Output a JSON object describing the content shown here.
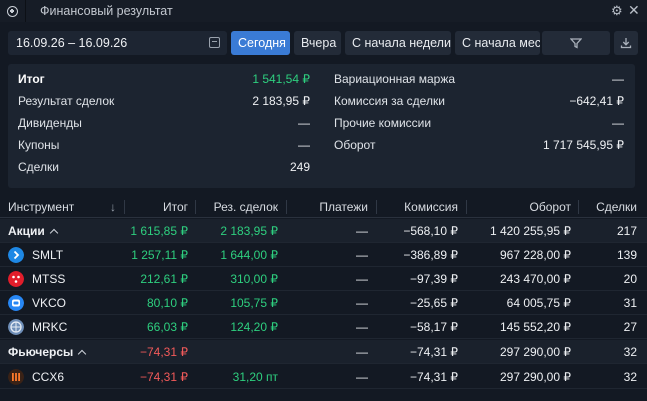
{
  "titlebar": {
    "title": "Финансовый результат"
  },
  "filters": {
    "date_range": "16.09.26 – 16.09.26",
    "buttons": [
      "Сегодня",
      "Вчера",
      "С начала недели",
      "С начала месяца"
    ],
    "active": "Сегодня"
  },
  "summary": {
    "left": [
      {
        "label": "Итог",
        "value": "1 541,54 ₽"
      },
      {
        "label": "Результат сделок",
        "value": "2 183,95 ₽"
      },
      {
        "label": "Дивиденды",
        "value": "—"
      },
      {
        "label": "Купоны",
        "value": "—"
      },
      {
        "label": "Сделки",
        "value": "249"
      }
    ],
    "right": [
      {
        "label": "Вариационная маржа",
        "value": "—"
      },
      {
        "label": "Комиссия за сделки",
        "value": "−642,41 ₽"
      },
      {
        "label": "Прочие комиссии",
        "value": "—"
      },
      {
        "label": "Оборот",
        "value": "1 717 545,95 ₽"
      }
    ]
  },
  "table": {
    "headers": [
      "Инструмент",
      "↓",
      "Итог",
      "Рез. сделок",
      "Платежи",
      "Комиссия",
      "Оборот",
      "Сделки"
    ],
    "rows": [
      {
        "instrument": "Акции",
        "group": true,
        "total": "1 615,85 ₽",
        "result": "2 183,95 ₽",
        "payments": "—",
        "commission": "−568,10 ₽",
        "turnover": "1 420 255,95 ₽",
        "deals": "217"
      },
      {
        "instrument": "SMLT",
        "group": false,
        "total": "1 257,11 ₽",
        "result": "1 644,00 ₽",
        "payments": "—",
        "commission": "−386,89 ₽",
        "turnover": "967 228,00 ₽",
        "deals": "139"
      },
      {
        "instrument": "MTSS",
        "group": false,
        "total": "212,61 ₽",
        "result": "310,00 ₽",
        "payments": "—",
        "commission": "−97,39 ₽",
        "turnover": "243 470,00 ₽",
        "deals": "20"
      },
      {
        "instrument": "VKCO",
        "group": false,
        "total": "80,10 ₽",
        "result": "105,75 ₽",
        "payments": "—",
        "commission": "−25,65 ₽",
        "turnover": "64 005,75 ₽",
        "deals": "31"
      },
      {
        "instrument": "MRKC",
        "group": false,
        "total": "66,03 ₽",
        "result": "124,20 ₽",
        "payments": "—",
        "commission": "−58,17 ₽",
        "turnover": "145 552,20 ₽",
        "deals": "27"
      },
      {
        "instrument": "Фьючерсы",
        "group": true,
        "total": "−74,31 ₽",
        "result": "",
        "payments": "—",
        "commission": "−74,31 ₽",
        "turnover": "297 290,00 ₽",
        "deals": "32"
      },
      {
        "instrument": "CCX6",
        "group": false,
        "total": "−74,31 ₽",
        "result": "31,20 пт",
        "payments": "—",
        "commission": "−74,31 ₽",
        "turnover": "297 290,00 ₽",
        "deals": "32"
      }
    ]
  },
  "colors": {
    "positive": "#2ecf7f",
    "negative": "#f25a5a",
    "accent": "#3a7bd5",
    "background": "#131923"
  },
  "icons": {
    "add": "plus-circle-icon",
    "settings": "gear-icon",
    "close": "close-icon",
    "calendar": "calendar-icon",
    "filter": "filter-icon",
    "download": "download-icon"
  }
}
